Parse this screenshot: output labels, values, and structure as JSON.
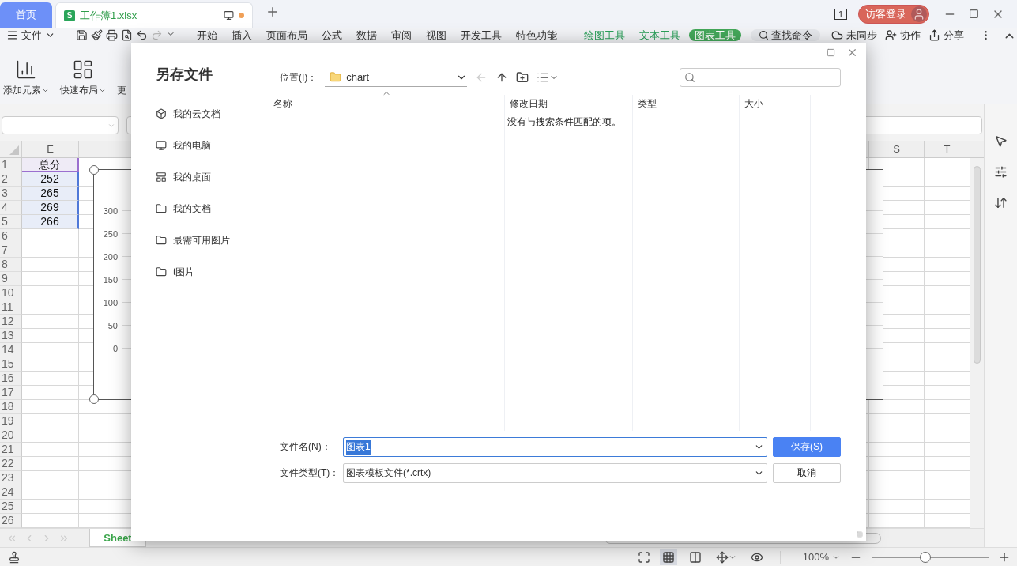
{
  "title_bar": {
    "tabs": [
      {
        "label": "首页",
        "kind": "home",
        "selected": false
      },
      {
        "label": "工作簿1.xlsx",
        "kind": "file",
        "selected": true,
        "app_icon": "S",
        "unsaved": true
      }
    ],
    "page_count": "1",
    "login": "访客登录"
  },
  "menu": {
    "file": "文件",
    "tabs": [
      {
        "label": "开始",
        "kind": "plain",
        "selected": false
      },
      {
        "label": "插入",
        "kind": "plain",
        "selected": false
      },
      {
        "label": "页面布局",
        "kind": "plain",
        "selected": false
      },
      {
        "label": "公式",
        "kind": "plain",
        "selected": false
      },
      {
        "label": "数据",
        "kind": "plain",
        "selected": false
      },
      {
        "label": "审阅",
        "kind": "plain",
        "selected": false
      },
      {
        "label": "视图",
        "kind": "plain",
        "selected": false
      },
      {
        "label": "开发工具",
        "kind": "plain",
        "selected": false
      },
      {
        "label": "特色功能",
        "kind": "plain",
        "selected": false
      },
      {
        "label": "绘图工具",
        "kind": "context",
        "selected": false
      },
      {
        "label": "文本工具",
        "kind": "context",
        "selected": false
      },
      {
        "label": "图表工具",
        "kind": "context",
        "selected": true
      }
    ],
    "search": "查找命令",
    "actions": [
      {
        "label": "未同步",
        "kind": "sync"
      },
      {
        "label": "协作",
        "kind": "collaborate"
      },
      {
        "label": "分享",
        "kind": "share"
      }
    ]
  },
  "ribbon": {
    "buttons": [
      {
        "label": "添加元素",
        "kind": "add_element"
      },
      {
        "label": "快速布局",
        "kind": "quick_layout"
      },
      {
        "label": "更",
        "kind": "more"
      }
    ]
  },
  "sheet": {
    "columns": [
      "E",
      "S",
      "T"
    ],
    "rows": [
      {
        "number": "1",
        "value": "总分",
        "kind": "header"
      },
      {
        "number": "2",
        "value": "252",
        "kind": "value"
      },
      {
        "number": "3",
        "value": "265",
        "kind": "value"
      },
      {
        "number": "4",
        "value": "269",
        "kind": "value"
      },
      {
        "number": "5",
        "value": "266",
        "kind": "value"
      },
      {
        "number": "6"
      },
      {
        "number": "7"
      },
      {
        "number": "8"
      },
      {
        "number": "9"
      },
      {
        "number": "10"
      },
      {
        "number": "11"
      },
      {
        "number": "12"
      },
      {
        "number": "13"
      },
      {
        "number": "14"
      },
      {
        "number": "15"
      },
      {
        "number": "16"
      },
      {
        "number": "17"
      },
      {
        "number": "18"
      },
      {
        "number": "19"
      },
      {
        "number": "20"
      },
      {
        "number": "21"
      },
      {
        "number": "22"
      },
      {
        "number": "23"
      },
      {
        "number": "24"
      },
      {
        "number": "25"
      },
      {
        "number": "26"
      }
    ],
    "sheet_tab": "Sheet"
  },
  "chart": {
    "axis_labels": [
      "300",
      "250",
      "200",
      "150",
      "100",
      "50",
      "0"
    ]
  },
  "dialog": {
    "title": "另存文件",
    "places": [
      {
        "label": "我的云文档",
        "kind": "cloud"
      },
      {
        "label": "我的电脑",
        "kind": "computer"
      },
      {
        "label": "我的桌面",
        "kind": "desktop"
      },
      {
        "label": "我的文档",
        "kind": "folder"
      },
      {
        "label": "最需可用图片",
        "kind": "folder"
      },
      {
        "label": "t图片",
        "kind": "folder"
      }
    ],
    "location_label": "位置(I)：",
    "location": "chart",
    "columns": [
      "名称",
      "修改日期",
      "类型",
      "大小"
    ],
    "empty_message": "没有与搜索条件匹配的项。",
    "file_name_label": "文件名(N)：",
    "file_name": "图表1",
    "file_type_label": "文件类型(T)：",
    "file_type": "图表模板文件(*.crtx)",
    "save": "保存(S)",
    "cancel": "取消"
  },
  "status_bar": {
    "views": [
      {
        "kind": "normal",
        "selected": true
      },
      {
        "kind": "page_break",
        "selected": false
      },
      {
        "kind": "layout",
        "selected": false
      },
      {
        "kind": "reading",
        "selected": false
      }
    ],
    "zoom": "100%",
    "level": 0.46
  }
}
